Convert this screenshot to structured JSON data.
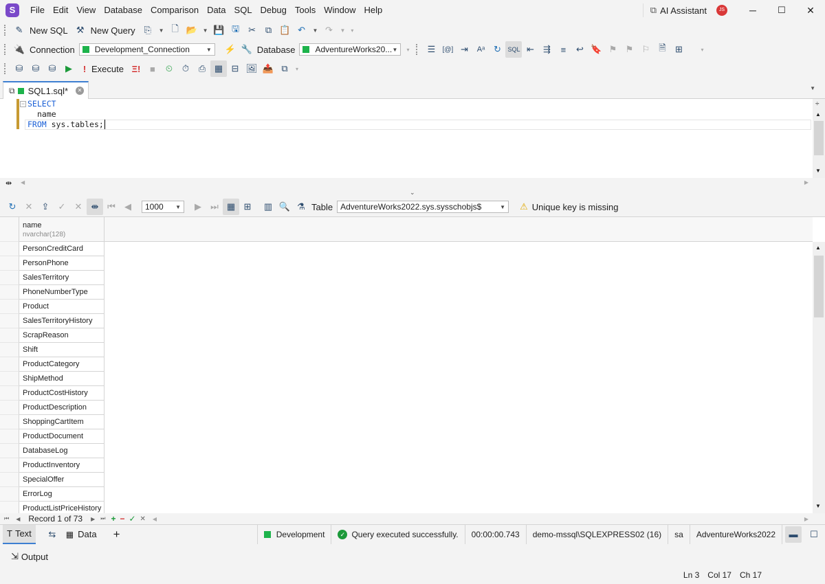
{
  "menu": [
    "File",
    "Edit",
    "View",
    "Database",
    "Comparison",
    "Data",
    "SQL",
    "Debug",
    "Tools",
    "Window",
    "Help"
  ],
  "menu_underline": [
    "F",
    "E",
    "V",
    "D",
    "C",
    "D",
    "S",
    "b",
    "T",
    "W",
    "H"
  ],
  "ai_assistant": "AI Assistant",
  "avatar": "JS",
  "toolbar1": {
    "new_sql": "New SQL",
    "new_query": "New Query"
  },
  "toolbar2": {
    "connection_label": "Connection",
    "connection_value": "Development_Connection",
    "database_label": "Database",
    "database_value": "AdventureWorks20..."
  },
  "toolbar3": {
    "execute": "Execute"
  },
  "tab": {
    "title": "SQL1.sql*"
  },
  "editor": {
    "line1": "SELECT",
    "line2": "name",
    "line3_kw": "FROM",
    "line3_rest": " sys.tables;"
  },
  "results_toolbar": {
    "page_size": "1000",
    "table_label": "Table",
    "table_value": "AdventureWorks2022.sys.sysschobjs$",
    "warning": "Unique key is missing"
  },
  "grid": {
    "column": {
      "name": "name",
      "type": "nvarchar(128)"
    },
    "rows": [
      "PersonCreditCard",
      "PersonPhone",
      "SalesTerritory",
      "PhoneNumberType",
      "Product",
      "SalesTerritoryHistory",
      "ScrapReason",
      "Shift",
      "ProductCategory",
      "ShipMethod",
      "ProductCostHistory",
      "ProductDescription",
      "ShoppingCartItem",
      "ProductDocument",
      "DatabaseLog",
      "ProductInventory",
      "SpecialOffer",
      "ErrorLog",
      "ProductListPriceHistory"
    ]
  },
  "nav": {
    "record": "Record 1 of 73"
  },
  "status": {
    "text_tab": "Text",
    "data_tab": "Data",
    "connection": "Development",
    "message": "Query executed successfully.",
    "duration": "00:00:00.743",
    "server": "demo-mssql\\SQLEXPRESS02 (16)",
    "user": "sa",
    "database": "AdventureWorks2022"
  },
  "output": "Output",
  "position": {
    "ln": "Ln 3",
    "col": "Col 17",
    "ch": "Ch 17"
  },
  "colors": {
    "accent": "#3d7fd1",
    "keyword": "#1a5fd6",
    "connection_green": "#1db34b",
    "logo": "#7a49c9"
  }
}
